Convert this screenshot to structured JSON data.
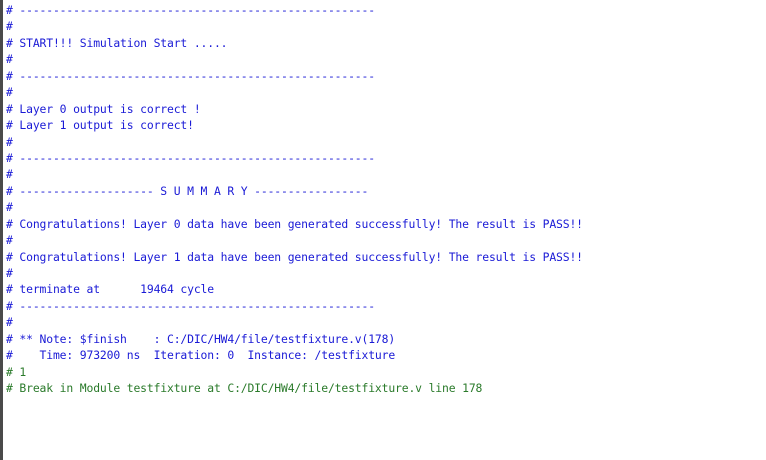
{
  "transcript": {
    "colors": {
      "blue": "#1a1ad6",
      "green": "#2a7a2a",
      "prompt": "#1a1ad6"
    },
    "lines": [
      {
        "text": "# -----------------------------------------------------",
        "color": "blue"
      },
      {
        "text": "#",
        "color": "blue"
      },
      {
        "text": "# START!!! Simulation Start .....",
        "color": "blue"
      },
      {
        "text": "#",
        "color": "blue"
      },
      {
        "text": "# -----------------------------------------------------",
        "color": "blue"
      },
      {
        "text": "#",
        "color": "blue"
      },
      {
        "text": "# Layer 0 output is correct !",
        "color": "blue"
      },
      {
        "text": "# Layer 1 output is correct!",
        "color": "blue"
      },
      {
        "text": "#",
        "color": "blue"
      },
      {
        "text": "# -----------------------------------------------------",
        "color": "blue"
      },
      {
        "text": "#",
        "color": "blue"
      },
      {
        "text": "# -------------------- S U M M A R Y -----------------",
        "color": "blue"
      },
      {
        "text": "#",
        "color": "blue"
      },
      {
        "text": "# Congratulations! Layer 0 data have been generated successfully! The result is PASS!!",
        "color": "blue"
      },
      {
        "text": "#",
        "color": "blue"
      },
      {
        "text": "# Congratulations! Layer 1 data have been generated successfully! The result is PASS!!",
        "color": "blue"
      },
      {
        "text": "#",
        "color": "blue"
      },
      {
        "text": "# terminate at      19464 cycle",
        "color": "blue"
      },
      {
        "text": "# -----------------------------------------------------",
        "color": "blue"
      },
      {
        "text": "#",
        "color": "blue"
      },
      {
        "text": "# ** Note: $finish    : C:/DIC/HW4/file/testfixture.v(178)",
        "color": "blue"
      },
      {
        "text": "#    Time: 973200 ns  Iteration: 0  Instance: /testfixture",
        "color": "blue"
      },
      {
        "text": "# 1",
        "color": "green"
      },
      {
        "text": "# Break in Module testfixture at C:/DIC/HW4/file/testfixture.v line 178",
        "color": "green"
      }
    ]
  }
}
